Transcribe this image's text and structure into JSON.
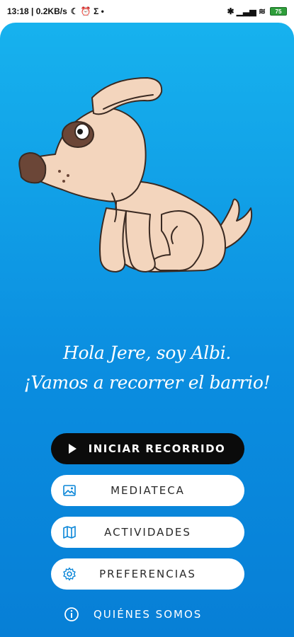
{
  "status_bar": {
    "time_and_speed": "13:18 | 0.2KB/s",
    "extra_glyphs": "☾ ⏰ Σ •",
    "right_glyphs": "✱ ▁▃▅ ≋",
    "battery": "75"
  },
  "mascot": {
    "name": "Albi",
    "icon": "dog-mascot-illustration"
  },
  "greeting": {
    "line1": "Hola Jere, soy Albi.",
    "line2": "¡Vamos a recorrer el barrio!"
  },
  "menu": {
    "start_tour": "INICIAR RECORRIDO",
    "media_library": "MEDIATECA",
    "activities": "ACTIVIDADES",
    "preferences": "PREFERENCIAS",
    "about_us": "QUIÉNES SOMOS"
  },
  "colors": {
    "background_top": "#17b2ee",
    "background_bottom": "#077fd6",
    "primary_button": "#0b0b0b",
    "secondary_button": "#ffffff",
    "dog_body": "#f3d5bd",
    "dog_spot": "#6b4637"
  }
}
